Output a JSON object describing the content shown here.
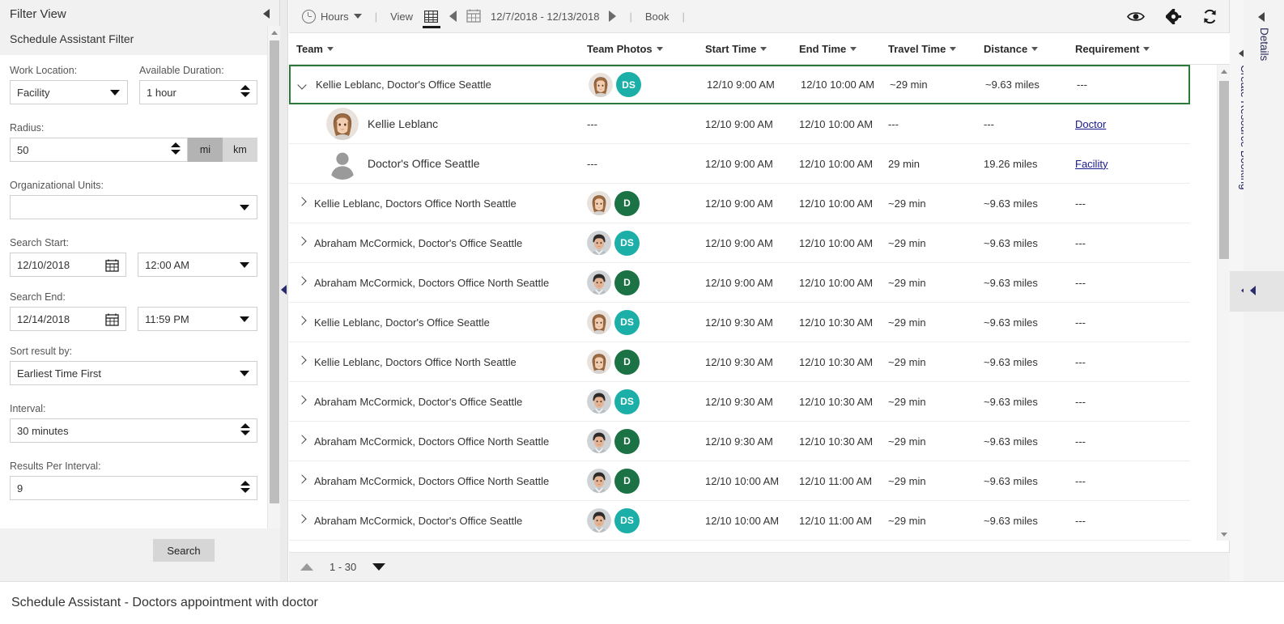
{
  "filter_panel": {
    "title": "Filter View",
    "subtitle": "Schedule Assistant Filter",
    "collapse_icon": "collapse-left-triangle-icon",
    "fields": {
      "work_location_label": "Work Location:",
      "work_location_value": "Facility",
      "available_duration_label": "Available Duration:",
      "available_duration_value": "1 hour",
      "radius_label": "Radius:",
      "radius_value": "50",
      "unit_mi": "mi",
      "unit_km": "km",
      "unit_selected": "mi",
      "org_units_label": "Organizational Units:",
      "org_units_value": "",
      "search_start_label": "Search Start:",
      "search_start_date": "12/10/2018",
      "search_start_time": "12:00 AM",
      "search_end_label": "Search End:",
      "search_end_date": "12/14/2018",
      "search_end_time": "11:59 PM",
      "sort_label": "Sort result by:",
      "sort_value": "Earliest Time First",
      "interval_label": "Interval:",
      "interval_value": "30 minutes",
      "results_per_interval_label": "Results Per Interval:",
      "results_per_interval_value": "9"
    },
    "search_button": "Search"
  },
  "toolbar": {
    "hours_label": "Hours",
    "view_label": "View",
    "date_range": "12/7/2018 - 12/13/2018",
    "book_label": "Book",
    "separator": "|",
    "icons": {
      "clock": "clock-icon",
      "caret": "chevron-down-icon",
      "grid": "grid-view-icon",
      "prev": "chevron-left-icon",
      "calendar": "calendar-icon",
      "next": "chevron-right-icon",
      "eye": "eye-icon",
      "gear": "gear-icon",
      "refresh": "refresh-icon"
    }
  },
  "grid": {
    "columns": [
      {
        "key": "team",
        "label": "Team"
      },
      {
        "key": "photos",
        "label": "Team Photos"
      },
      {
        "key": "start",
        "label": "Start Time"
      },
      {
        "key": "end",
        "label": "End Time"
      },
      {
        "key": "travel",
        "label": "Travel Time"
      },
      {
        "key": "distance",
        "label": "Distance"
      },
      {
        "key": "requirement",
        "label": "Requirement"
      }
    ],
    "rows": [
      {
        "team": "Kellie Leblanc, Doctor's Office Seattle",
        "expanded": true,
        "selected": true,
        "badge": "DS",
        "badge_color": "#1BAFA8",
        "avatar": "woman-photo",
        "start": "12/10 9:00 AM",
        "end": "12/10 10:00 AM",
        "travel": "~29 min",
        "distance": "~9.63 miles",
        "requirement": "---",
        "children": [
          {
            "name": "Kellie Leblanc",
            "avatar": "woman-photo",
            "photos": "---",
            "start": "12/10 9:00 AM",
            "end": "12/10 10:00 AM",
            "travel": "---",
            "distance": "---",
            "requirement": "Doctor"
          },
          {
            "name": "Doctor's Office Seattle",
            "avatar": "generic-person",
            "photos": "---",
            "start": "12/10 9:00 AM",
            "end": "12/10 10:00 AM",
            "travel": "29 min",
            "distance": "19.26 miles",
            "requirement": "Facility"
          }
        ]
      },
      {
        "team": "Kellie Leblanc, Doctors Office North Seattle",
        "expanded": false,
        "selected": false,
        "badge": "D",
        "badge_color": "#1B7244",
        "avatar": "woman-photo",
        "start": "12/10 9:00 AM",
        "end": "12/10 10:00 AM",
        "travel": "~29 min",
        "distance": "~9.63 miles",
        "requirement": "---"
      },
      {
        "team": "Abraham McCormick, Doctor's Office Seattle",
        "expanded": false,
        "selected": false,
        "badge": "DS",
        "badge_color": "#1BAFA8",
        "avatar": "man-photo",
        "start": "12/10 9:00 AM",
        "end": "12/10 10:00 AM",
        "travel": "~29 min",
        "distance": "~9.63 miles",
        "requirement": "---"
      },
      {
        "team": "Abraham McCormick, Doctors Office North Seattle",
        "expanded": false,
        "selected": false,
        "badge": "D",
        "badge_color": "#1B7244",
        "avatar": "man-photo",
        "start": "12/10 9:00 AM",
        "end": "12/10 10:00 AM",
        "travel": "~29 min",
        "distance": "~9.63 miles",
        "requirement": "---"
      },
      {
        "team": "Kellie Leblanc, Doctor's Office Seattle",
        "expanded": false,
        "selected": false,
        "badge": "DS",
        "badge_color": "#1BAFA8",
        "avatar": "woman-photo",
        "start": "12/10 9:30 AM",
        "end": "12/10 10:30 AM",
        "travel": "~29 min",
        "distance": "~9.63 miles",
        "requirement": "---"
      },
      {
        "team": "Kellie Leblanc, Doctors Office North Seattle",
        "expanded": false,
        "selected": false,
        "badge": "D",
        "badge_color": "#1B7244",
        "avatar": "woman-photo",
        "start": "12/10 9:30 AM",
        "end": "12/10 10:30 AM",
        "travel": "~29 min",
        "distance": "~9.63 miles",
        "requirement": "---"
      },
      {
        "team": "Abraham McCormick, Doctor's Office Seattle",
        "expanded": false,
        "selected": false,
        "badge": "DS",
        "badge_color": "#1BAFA8",
        "avatar": "man-photo",
        "start": "12/10 9:30 AM",
        "end": "12/10 10:30 AM",
        "travel": "~29 min",
        "distance": "~9.63 miles",
        "requirement": "---"
      },
      {
        "team": "Abraham McCormick, Doctors Office North Seattle",
        "expanded": false,
        "selected": false,
        "badge": "D",
        "badge_color": "#1B7244",
        "avatar": "man-photo",
        "start": "12/10 9:30 AM",
        "end": "12/10 10:30 AM",
        "travel": "~29 min",
        "distance": "~9.63 miles",
        "requirement": "---"
      },
      {
        "team": "Abraham McCormick, Doctors Office North Seattle",
        "expanded": false,
        "selected": false,
        "badge": "D",
        "badge_color": "#1B7244",
        "avatar": "man-photo",
        "start": "12/10 10:00 AM",
        "end": "12/10 11:00 AM",
        "travel": "~29 min",
        "distance": "~9.63 miles",
        "requirement": "---"
      },
      {
        "team": "Abraham McCormick, Doctor's Office Seattle",
        "expanded": false,
        "selected": false,
        "badge": "DS",
        "badge_color": "#1BAFA8",
        "avatar": "man-photo",
        "start": "12/10 10:00 AM",
        "end": "12/10 11:00 AM",
        "travel": "~29 min",
        "distance": "~9.63 miles",
        "requirement": "---"
      }
    ]
  },
  "pager": {
    "range": "1 - 30",
    "up_icon": "chevron-up-icon",
    "down_icon": "chevron-down-icon"
  },
  "right_panels": {
    "create_resource_booking": "Create Resource Booking",
    "details": "Details"
  },
  "statusbar": {
    "text": "Schedule Assistant - Doctors appointment with doctor"
  },
  "colors": {
    "selection_green": "#2b7a39",
    "badge_teal": "#1BAFA8",
    "badge_green": "#1B7244",
    "link_blue": "#1a1a8c"
  }
}
